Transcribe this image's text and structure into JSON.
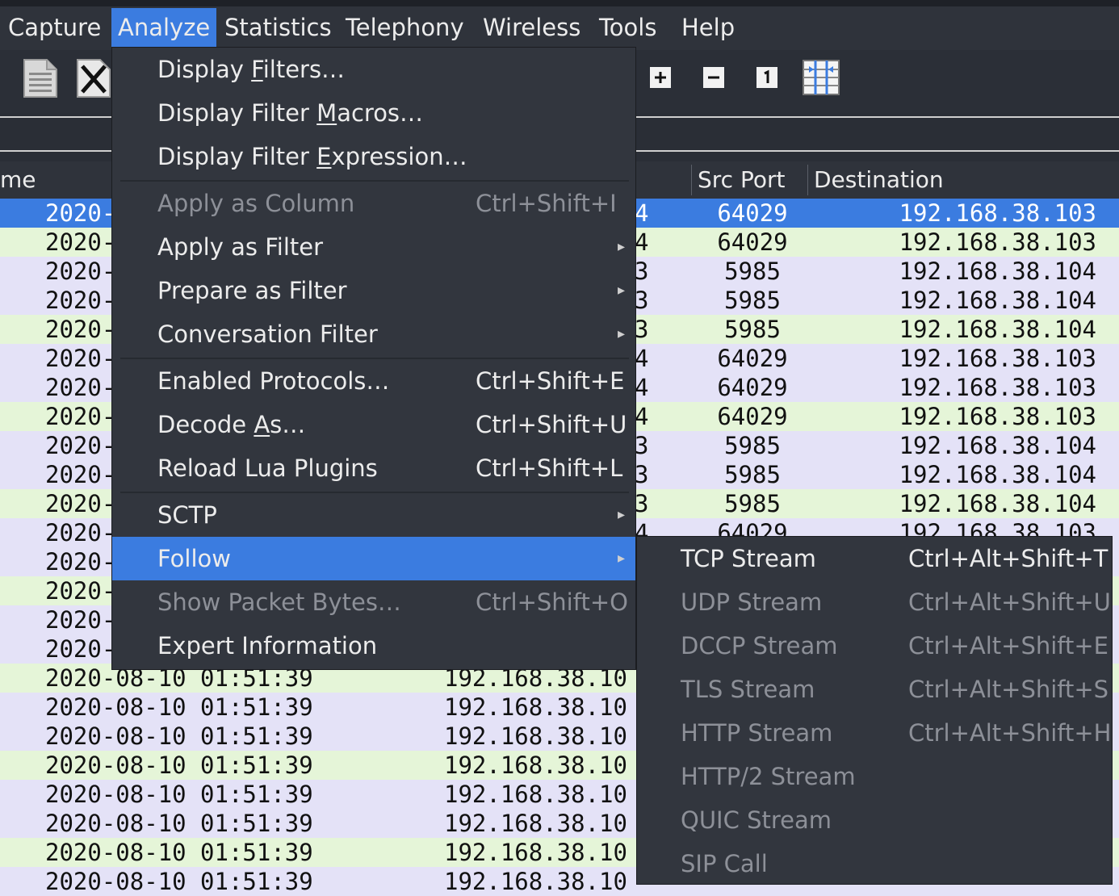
{
  "menubar": {
    "items": [
      {
        "label": "Capture",
        "active": false
      },
      {
        "label": "Analyze",
        "active": true
      },
      {
        "label": "Statistics",
        "active": false
      },
      {
        "label": "Telephony",
        "active": false
      },
      {
        "label": "Wireless",
        "active": false
      },
      {
        "label": "Tools",
        "active": false
      },
      {
        "label": "Help",
        "active": false
      }
    ]
  },
  "toolbar": {
    "icons": [
      "file-binary-icon",
      "close-file-icon",
      "zoom-in-icon",
      "zoom-out-icon",
      "normal-size-icon",
      "resize-columns-icon"
    ]
  },
  "packet_list": {
    "columns": {
      "time_partial": "me",
      "src_port": "Src Port",
      "destination": "Destination"
    },
    "rows": [
      {
        "time": "2020-",
        "src_partial": "4",
        "src_port": "64029",
        "destination": "192.168.38.103",
        "selected": true,
        "color": "#3b7ce0"
      },
      {
        "time": "2020-",
        "src_partial": "4",
        "src_port": "64029",
        "destination": "192.168.38.103",
        "color": "#e5f5d8"
      },
      {
        "time": "2020-",
        "src_partial": "3",
        "src_port": "5985",
        "destination": "192.168.38.104",
        "color": "#e4e2f7"
      },
      {
        "time": "2020-",
        "src_partial": "3",
        "src_port": "5985",
        "destination": "192.168.38.104",
        "color": "#e4e2f7"
      },
      {
        "time": "2020-",
        "src_partial": "3",
        "src_port": "5985",
        "destination": "192.168.38.104",
        "color": "#e5f5d8"
      },
      {
        "time": "2020-",
        "src_partial": "4",
        "src_port": "64029",
        "destination": "192.168.38.103",
        "color": "#e4e2f7"
      },
      {
        "time": "2020-",
        "src_partial": "4",
        "src_port": "64029",
        "destination": "192.168.38.103",
        "color": "#e4e2f7"
      },
      {
        "time": "2020-",
        "src_partial": "4",
        "src_port": "64029",
        "destination": "192.168.38.103",
        "color": "#e5f5d8"
      },
      {
        "time": "2020-",
        "src_partial": "3",
        "src_port": "5985",
        "destination": "192.168.38.104",
        "color": "#e4e2f7"
      },
      {
        "time": "2020-",
        "src_partial": "3",
        "src_port": "5985",
        "destination": "192.168.38.104",
        "color": "#e4e2f7"
      },
      {
        "time": "2020-",
        "src_partial": "3",
        "src_port": "5985",
        "destination": "192.168.38.104",
        "color": "#e5f5d8"
      },
      {
        "time": "2020-",
        "src_partial": "4",
        "src_port": "64029",
        "destination": "192.168.38.103",
        "color": "#e4e2f7"
      },
      {
        "time": "2020-",
        "src_partial": "",
        "src_port": "",
        "destination": "",
        "color": "#e4e2f7"
      },
      {
        "time": "2020-",
        "src_partial": "",
        "src_port": "",
        "destination": "",
        "color": "#e5f5d8"
      },
      {
        "time": "2020-",
        "src_partial": "",
        "src_port": "",
        "destination": "",
        "color": "#e4e2f7"
      },
      {
        "time": "2020-",
        "src_partial": "",
        "src_port": "",
        "destination": "",
        "color": "#e4e2f7"
      },
      {
        "time": "2020-08-10 01:51:39",
        "src_partial": "192.168.38.10",
        "src_port": "",
        "destination": "",
        "color": "#e5f5d8"
      },
      {
        "time": "2020-08-10 01:51:39",
        "src_partial": "192.168.38.10",
        "src_port": "",
        "destination": "",
        "color": "#e4e2f7"
      },
      {
        "time": "2020-08-10 01:51:39",
        "src_partial": "192.168.38.10",
        "src_port": "",
        "destination": "",
        "color": "#e4e2f7"
      },
      {
        "time": "2020-08-10 01:51:39",
        "src_partial": "192.168.38.10",
        "src_port": "",
        "destination": "",
        "color": "#e5f5d8"
      },
      {
        "time": "2020-08-10 01:51:39",
        "src_partial": "192.168.38.10",
        "src_port": "",
        "destination": "",
        "color": "#e4e2f7"
      },
      {
        "time": "2020-08-10 01:51:39",
        "src_partial": "192.168.38.10",
        "src_port": "",
        "destination": "",
        "color": "#e4e2f7"
      },
      {
        "time": "2020-08-10 01:51:39",
        "src_partial": "192.168.38.10",
        "src_port": "",
        "destination": "",
        "color": "#e5f5d8"
      },
      {
        "time": "2020-08-10 01:51:39",
        "src_partial": "192.168.38.10",
        "src_port": "",
        "destination": "",
        "color": "#e4e2f7"
      }
    ]
  },
  "analyze_menu": {
    "items": [
      {
        "type": "item",
        "pre": "Display ",
        "mn": "F",
        "post": "ilters…",
        "shortcut": "",
        "submenu": false,
        "disabled": false
      },
      {
        "type": "item",
        "pre": "Display Filter ",
        "mn": "M",
        "post": "acros…",
        "shortcut": "",
        "submenu": false,
        "disabled": false
      },
      {
        "type": "item",
        "pre": "Display Filter ",
        "mn": "E",
        "post": "xpression…",
        "shortcut": "",
        "submenu": false,
        "disabled": false
      },
      {
        "type": "sep"
      },
      {
        "type": "item",
        "pre": "Apply as Column",
        "mn": "",
        "post": "",
        "shortcut": "Ctrl+Shift+I",
        "submenu": false,
        "disabled": true
      },
      {
        "type": "item",
        "pre": "Apply as Filter",
        "mn": "",
        "post": "",
        "shortcut": "",
        "submenu": true,
        "disabled": false
      },
      {
        "type": "item",
        "pre": "Prepare as Filter",
        "mn": "",
        "post": "",
        "shortcut": "",
        "submenu": true,
        "disabled": false
      },
      {
        "type": "item",
        "pre": "Conversation Filter",
        "mn": "",
        "post": "",
        "shortcut": "",
        "submenu": true,
        "disabled": false
      },
      {
        "type": "sep"
      },
      {
        "type": "item",
        "pre": "Enabled Protocols…",
        "mn": "",
        "post": "",
        "shortcut": "Ctrl+Shift+E",
        "submenu": false,
        "disabled": false
      },
      {
        "type": "item",
        "pre": "Decode ",
        "mn": "A",
        "post": "s…",
        "shortcut": "Ctrl+Shift+U",
        "submenu": false,
        "disabled": false
      },
      {
        "type": "item",
        "pre": "Reload Lua Plugins",
        "mn": "",
        "post": "",
        "shortcut": "Ctrl+Shift+L",
        "submenu": false,
        "disabled": false
      },
      {
        "type": "sep"
      },
      {
        "type": "item",
        "pre": "SCTP",
        "mn": "",
        "post": "",
        "shortcut": "",
        "submenu": true,
        "disabled": false
      },
      {
        "type": "item",
        "pre": "Follow",
        "mn": "",
        "post": "",
        "shortcut": "",
        "submenu": true,
        "disabled": false,
        "highlighted": true
      },
      {
        "type": "item",
        "pre": "Show Packet Bytes…",
        "mn": "",
        "post": "",
        "shortcut": "Ctrl+Shift+O",
        "submenu": false,
        "disabled": true
      },
      {
        "type": "item",
        "pre": "Expert Information",
        "mn": "",
        "post": "",
        "shortcut": "",
        "submenu": false,
        "disabled": false
      }
    ]
  },
  "follow_menu": {
    "items": [
      {
        "label": "TCP Stream",
        "shortcut": "Ctrl+Alt+Shift+T",
        "disabled": false
      },
      {
        "label": "UDP Stream",
        "shortcut": "Ctrl+Alt+Shift+U",
        "disabled": true
      },
      {
        "label": "DCCP Stream",
        "shortcut": "Ctrl+Alt+Shift+E",
        "disabled": true
      },
      {
        "label": "TLS Stream",
        "shortcut": "Ctrl+Alt+Shift+S",
        "disabled": true
      },
      {
        "label": "HTTP Stream",
        "shortcut": "Ctrl+Alt+Shift+H",
        "disabled": true
      },
      {
        "label": "HTTP/2 Stream",
        "shortcut": "",
        "disabled": true
      },
      {
        "label": "QUIC Stream",
        "shortcut": "",
        "disabled": true
      },
      {
        "label": "SIP Call",
        "shortcut": "",
        "disabled": true
      }
    ]
  },
  "colors": {
    "accent": "#3b7ce0",
    "row_green": "#e5f5d8",
    "row_lavender": "#e4e2f7"
  }
}
